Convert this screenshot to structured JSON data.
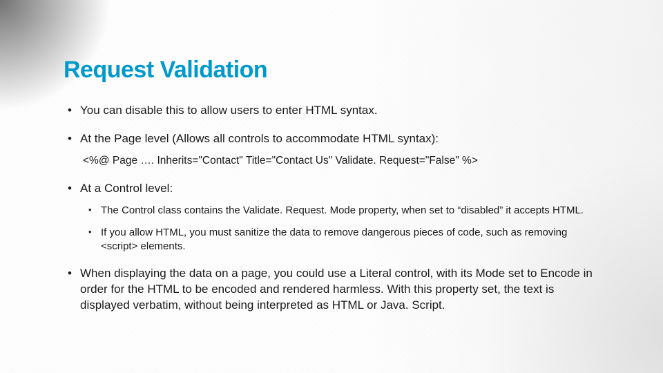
{
  "slide": {
    "title": "Request Validation",
    "bullets": [
      {
        "text": "You can disable this to allow users to enter HTML syntax."
      },
      {
        "text": "At the Page level (Allows all controls to accommodate HTML syntax):",
        "code": "<%@ Page …. Inherits=\"Contact\" Title=\"Contact Us\" Validate. Request=\"False\" %>"
      },
      {
        "text": "At a Control level:",
        "sub": [
          "The Control class contains the Validate. Request. Mode property, when set to “disabled” it accepts HTML.",
          "If you allow HTML, you must sanitize the data to remove dangerous pieces of code, such as removing <script> elements."
        ]
      },
      {
        "text": "When displaying the data on a page, you could use a Literal control, with its Mode set to Encode in order for the HTML to be encoded and rendered harmless. With this property set, the text is displayed verbatim, without being interpreted as HTML or Java. Script."
      }
    ]
  }
}
